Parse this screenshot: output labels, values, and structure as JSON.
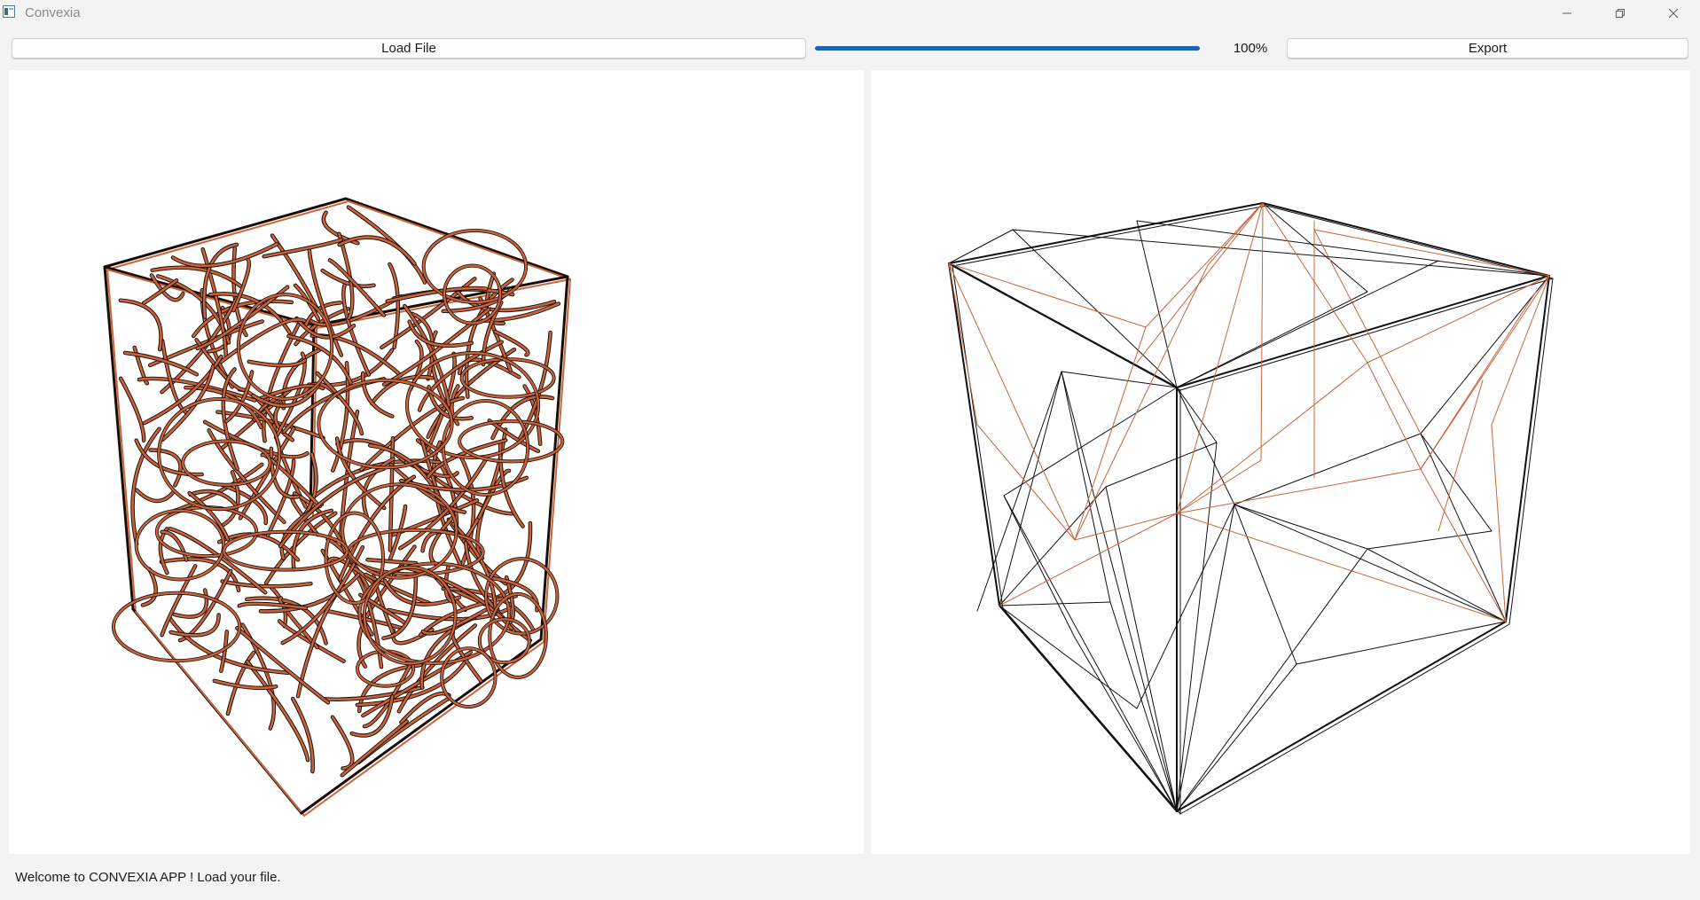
{
  "window": {
    "title": "Convexia"
  },
  "toolbar": {
    "load_label": "Load File",
    "export_label": "Export",
    "progress_value": 100,
    "progress_text": "100%"
  },
  "status": {
    "message": "Welcome to CONVEXIA APP ! Load your file."
  },
  "colors": {
    "accent": "#1a64b0",
    "mesh_copper": "#c8643c",
    "mesh_dark": "#1a0d08"
  },
  "icons": {
    "app": "app-window-icon",
    "minimize": "minimize-icon",
    "maximize": "restore-icon",
    "close": "close-icon"
  }
}
